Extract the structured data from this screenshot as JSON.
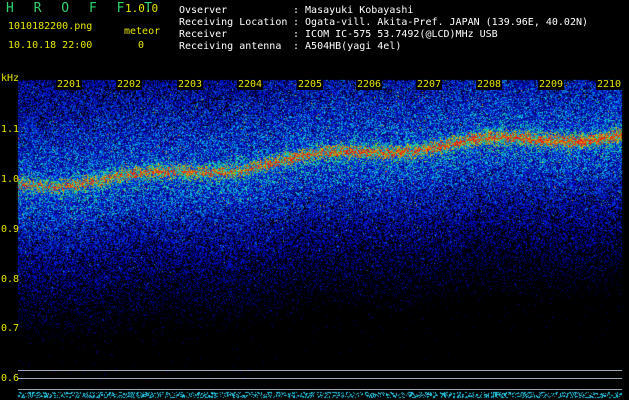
{
  "app": {
    "title": "H R O F F T",
    "version": "1.0.0"
  },
  "file": {
    "name": "1010182200.png",
    "datetime": "10.10.18 22:00"
  },
  "counter": {
    "label": "meteor",
    "value": "0"
  },
  "info": [
    {
      "label": "Ovserver",
      "value": ": Masayuki Kobayashi"
    },
    {
      "label": "Receiving Location",
      "value": ": Ogata-vill. Akita-Pref. JAPAN (139.96E, 40.02N)"
    },
    {
      "label": "Receiver",
      "value": ": ICOM IC-575 53.7492(@LCD)MHz USB"
    },
    {
      "label": "Receiving antenna",
      "value": ": A504HB(yagi 4el)"
    }
  ],
  "spectrogram": {
    "y_unit": "kHz",
    "y_ticks": [
      "1.1",
      "1.0",
      "0.9",
      "0.8",
      "0.7",
      "0.6"
    ],
    "x_ticks": [
      "2201",
      "2202",
      "2203",
      "2204",
      "2205",
      "2206",
      "2207",
      "2208",
      "2209",
      "2210"
    ]
  },
  "colors": {
    "label_yellow": "#e6e600",
    "title_green": "#2fd36f",
    "text_white": "#ffffff",
    "background": "#000000"
  }
}
